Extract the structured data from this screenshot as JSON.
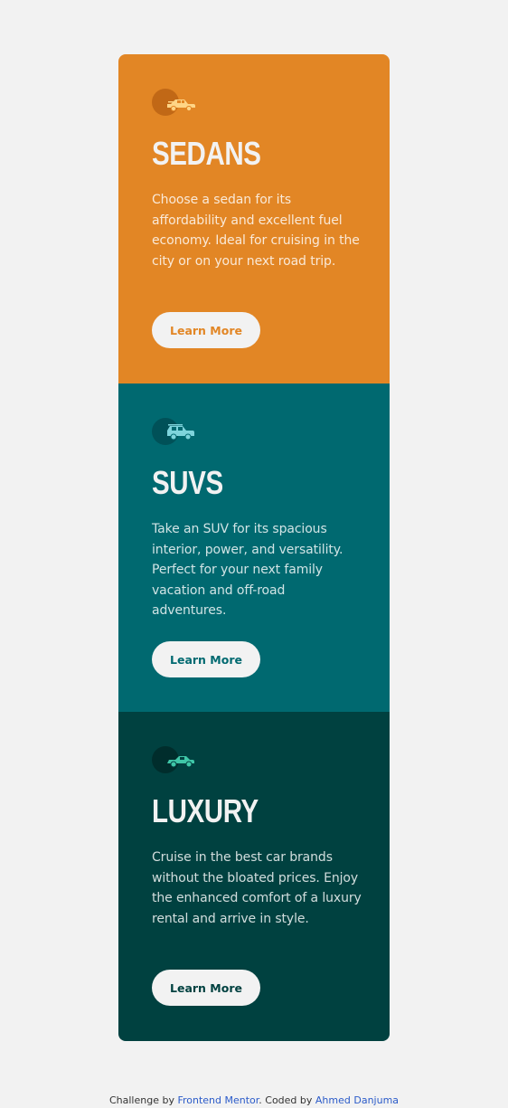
{
  "colors": {
    "page_background": "#f2f2f2",
    "sedans": "#e28625",
    "suvs": "#006970",
    "luxury": "#004140",
    "button_background": "#f2f2f2",
    "link": "#2b5bc9"
  },
  "cards": [
    {
      "icon": "sedan-car-icon",
      "title": "SEDANS",
      "text": "Choose a sedan for its affordability and excellent fuel economy. Ideal for cruising in the city or on your next road trip.",
      "button_label": "Learn More"
    },
    {
      "icon": "suv-car-icon",
      "title": "SUVS",
      "text": "Take an SUV for its spacious interior, power, and versatility. Perfect for your next family vacation and off-road adventures.",
      "button_label": "Learn More"
    },
    {
      "icon": "luxury-car-icon",
      "title": "LUXURY",
      "text": "Cruise in the best car brands without the bloated prices. Enjoy the enhanced comfort of a luxury rental and arrive in style.",
      "button_label": "Learn More"
    }
  ],
  "attribution": {
    "prefix": "Challenge by ",
    "challenge_link": "Frontend Mentor",
    "middle": ". Coded by ",
    "author_link": "Ahmed Danjuma"
  }
}
